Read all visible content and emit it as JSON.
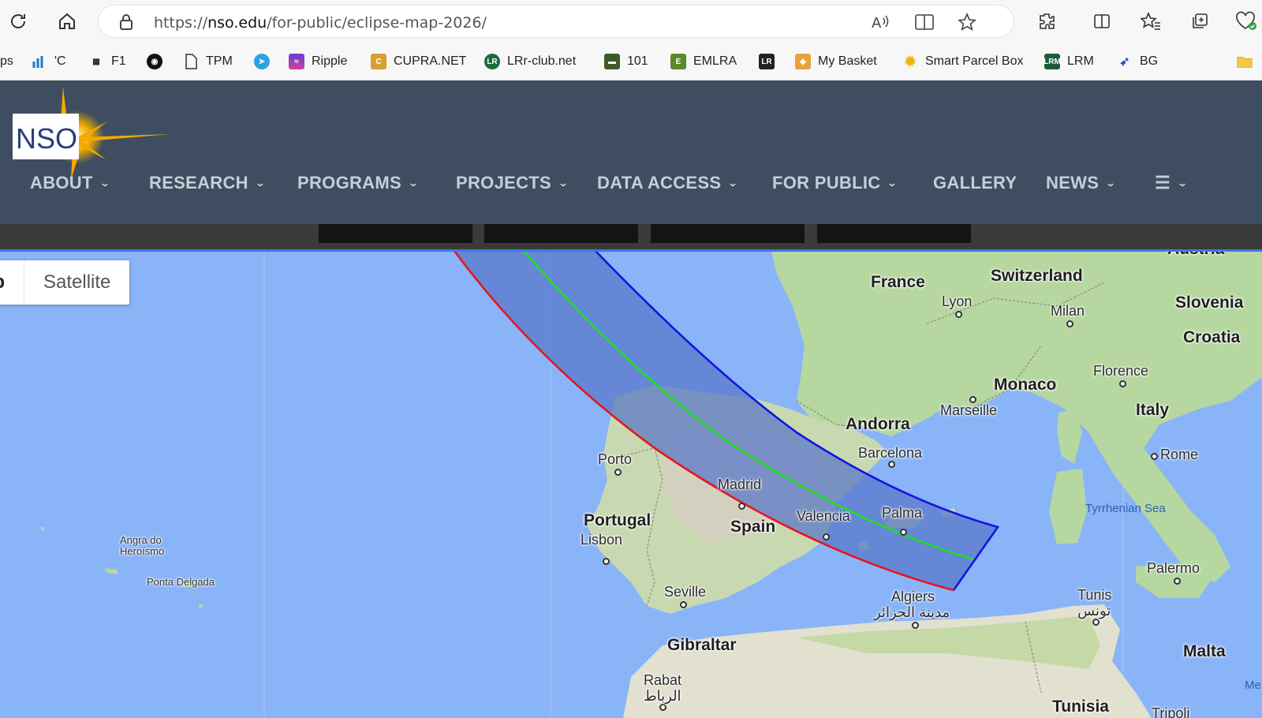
{
  "browser": {
    "url_scheme": "https://",
    "url_host": "nso.edu",
    "url_path": "/for-public/eclipse-map-2026/",
    "icons": [
      "refresh-icon",
      "home-icon",
      "lock-icon",
      "read-aloud-icon",
      "immersive-reader-icon",
      "favorite-star-icon",
      "extensions-icon",
      "split-screen-icon",
      "favorites-icon",
      "collections-icon",
      "health-icon"
    ]
  },
  "bookmarks": [
    {
      "label": "ps"
    },
    {
      "label": "'C"
    },
    {
      "label": "F1"
    },
    {
      "label": ""
    },
    {
      "label": "TPM"
    },
    {
      "label": ""
    },
    {
      "label": "Ripple"
    },
    {
      "label": "CUPRA.NET"
    },
    {
      "label": "LRr-club.net"
    },
    {
      "label": "101"
    },
    {
      "label": "EMLRA"
    },
    {
      "label": ""
    },
    {
      "label": "My Basket"
    },
    {
      "label": "Smart Parcel Box"
    },
    {
      "label": "LRM"
    },
    {
      "label": "BG"
    }
  ],
  "site": {
    "logo_text": "NSO",
    "nav": [
      {
        "label": "ABOUT",
        "has_menu": true
      },
      {
        "label": "RESEARCH",
        "has_menu": true
      },
      {
        "label": "PROGRAMS",
        "has_menu": true
      },
      {
        "label": "PROJECTS",
        "has_menu": true
      },
      {
        "label": "DATA ACCESS",
        "has_menu": true
      },
      {
        "label": "FOR PUBLIC",
        "has_menu": true
      },
      {
        "label": "GALLERY",
        "has_menu": false
      },
      {
        "label": "NEWS",
        "has_menu": true
      },
      {
        "label": "☰",
        "has_menu": true
      }
    ],
    "colors": {
      "header": "#3e4e60",
      "nav_text": "#c7ced6",
      "sun": "#f2a900"
    }
  },
  "map": {
    "type_options": {
      "map": "ap",
      "satellite": "Satellite"
    },
    "colors": {
      "water": "#8ab4f8",
      "land": "#b9d9a7",
      "path_fill": "#5876c8",
      "southern_limit": "#e8141c",
      "central_line": "#1fe01f",
      "northern_limit": "#1414e0"
    },
    "labels": {
      "france": "France",
      "switzerland": "Switzerland",
      "austria": "Austria",
      "slovenia": "Slovenia",
      "croatia": "Croatia",
      "lyon": "Lyon",
      "milan": "Milan",
      "florence": "Florence",
      "monaco": "Monaco",
      "marseille": "Marseille",
      "italy": "Italy",
      "rome": "Rome",
      "andorra": "Andorra",
      "barcelona": "Barcelona",
      "porto": "Porto",
      "madrid": "Madrid",
      "portugal": "Portugal",
      "lisbon": "Lisbon",
      "spain": "Spain",
      "valencia": "Valencia",
      "palma": "Palma",
      "tyrrhenian": "Tyrrhenian Sea",
      "palermo": "Palermo",
      "tunis": "Tunis",
      "tunis_ar": "تونس",
      "seville": "Seville",
      "algiers": "Algiers",
      "algiers_ar": "مدينة الجزائر",
      "gibraltar": "Gibraltar",
      "malta": "Malta",
      "rabat": "Rabat",
      "rabat_ar": "الرباط",
      "tunisia": "Tunisia",
      "tripoli": "Tripoli",
      "angra": "Angra do\nHeroísmo",
      "ponta": "Ponta Delgada",
      "me": "Me"
    }
  }
}
